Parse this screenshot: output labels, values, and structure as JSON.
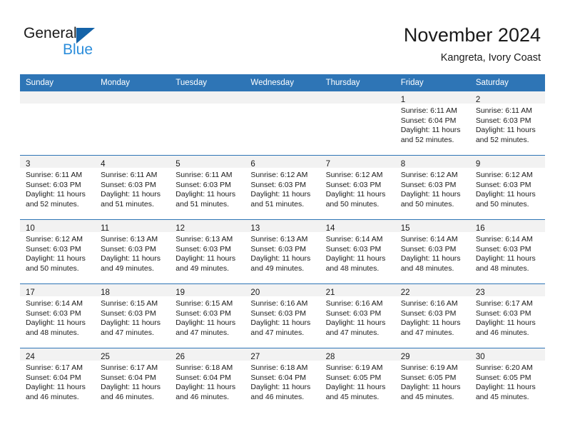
{
  "brand": {
    "line1": "General",
    "line2": "Blue",
    "triangle_color": "#1463a8",
    "blue_text_color": "#2b8ddb"
  },
  "header": {
    "title": "November 2024",
    "subtitle": "Kangreta, Ivory Coast"
  },
  "theme": {
    "header_row_bg": "#2e75b6",
    "header_row_text": "#ffffff",
    "daynum_bar_bg": "#f2f2f2",
    "cell_bg": "#ffffff",
    "grid_line": "#2e75b6"
  },
  "columns": [
    "Sunday",
    "Monday",
    "Tuesday",
    "Wednesday",
    "Thursday",
    "Friday",
    "Saturday"
  ],
  "weeks": [
    [
      {
        "day": "",
        "lines": []
      },
      {
        "day": "",
        "lines": []
      },
      {
        "day": "",
        "lines": []
      },
      {
        "day": "",
        "lines": []
      },
      {
        "day": "",
        "lines": []
      },
      {
        "day": "1",
        "lines": [
          "Sunrise: 6:11 AM",
          "Sunset: 6:04 PM",
          "Daylight: 11 hours",
          "and 52 minutes."
        ]
      },
      {
        "day": "2",
        "lines": [
          "Sunrise: 6:11 AM",
          "Sunset: 6:03 PM",
          "Daylight: 11 hours",
          "and 52 minutes."
        ]
      }
    ],
    [
      {
        "day": "3",
        "lines": [
          "Sunrise: 6:11 AM",
          "Sunset: 6:03 PM",
          "Daylight: 11 hours",
          "and 52 minutes."
        ]
      },
      {
        "day": "4",
        "lines": [
          "Sunrise: 6:11 AM",
          "Sunset: 6:03 PM",
          "Daylight: 11 hours",
          "and 51 minutes."
        ]
      },
      {
        "day": "5",
        "lines": [
          "Sunrise: 6:11 AM",
          "Sunset: 6:03 PM",
          "Daylight: 11 hours",
          "and 51 minutes."
        ]
      },
      {
        "day": "6",
        "lines": [
          "Sunrise: 6:12 AM",
          "Sunset: 6:03 PM",
          "Daylight: 11 hours",
          "and 51 minutes."
        ]
      },
      {
        "day": "7",
        "lines": [
          "Sunrise: 6:12 AM",
          "Sunset: 6:03 PM",
          "Daylight: 11 hours",
          "and 50 minutes."
        ]
      },
      {
        "day": "8",
        "lines": [
          "Sunrise: 6:12 AM",
          "Sunset: 6:03 PM",
          "Daylight: 11 hours",
          "and 50 minutes."
        ]
      },
      {
        "day": "9",
        "lines": [
          "Sunrise: 6:12 AM",
          "Sunset: 6:03 PM",
          "Daylight: 11 hours",
          "and 50 minutes."
        ]
      }
    ],
    [
      {
        "day": "10",
        "lines": [
          "Sunrise: 6:12 AM",
          "Sunset: 6:03 PM",
          "Daylight: 11 hours",
          "and 50 minutes."
        ]
      },
      {
        "day": "11",
        "lines": [
          "Sunrise: 6:13 AM",
          "Sunset: 6:03 PM",
          "Daylight: 11 hours",
          "and 49 minutes."
        ]
      },
      {
        "day": "12",
        "lines": [
          "Sunrise: 6:13 AM",
          "Sunset: 6:03 PM",
          "Daylight: 11 hours",
          "and 49 minutes."
        ]
      },
      {
        "day": "13",
        "lines": [
          "Sunrise: 6:13 AM",
          "Sunset: 6:03 PM",
          "Daylight: 11 hours",
          "and 49 minutes."
        ]
      },
      {
        "day": "14",
        "lines": [
          "Sunrise: 6:14 AM",
          "Sunset: 6:03 PM",
          "Daylight: 11 hours",
          "and 48 minutes."
        ]
      },
      {
        "day": "15",
        "lines": [
          "Sunrise: 6:14 AM",
          "Sunset: 6:03 PM",
          "Daylight: 11 hours",
          "and 48 minutes."
        ]
      },
      {
        "day": "16",
        "lines": [
          "Sunrise: 6:14 AM",
          "Sunset: 6:03 PM",
          "Daylight: 11 hours",
          "and 48 minutes."
        ]
      }
    ],
    [
      {
        "day": "17",
        "lines": [
          "Sunrise: 6:14 AM",
          "Sunset: 6:03 PM",
          "Daylight: 11 hours",
          "and 48 minutes."
        ]
      },
      {
        "day": "18",
        "lines": [
          "Sunrise: 6:15 AM",
          "Sunset: 6:03 PM",
          "Daylight: 11 hours",
          "and 47 minutes."
        ]
      },
      {
        "day": "19",
        "lines": [
          "Sunrise: 6:15 AM",
          "Sunset: 6:03 PM",
          "Daylight: 11 hours",
          "and 47 minutes."
        ]
      },
      {
        "day": "20",
        "lines": [
          "Sunrise: 6:16 AM",
          "Sunset: 6:03 PM",
          "Daylight: 11 hours",
          "and 47 minutes."
        ]
      },
      {
        "day": "21",
        "lines": [
          "Sunrise: 6:16 AM",
          "Sunset: 6:03 PM",
          "Daylight: 11 hours",
          "and 47 minutes."
        ]
      },
      {
        "day": "22",
        "lines": [
          "Sunrise: 6:16 AM",
          "Sunset: 6:03 PM",
          "Daylight: 11 hours",
          "and 47 minutes."
        ]
      },
      {
        "day": "23",
        "lines": [
          "Sunrise: 6:17 AM",
          "Sunset: 6:03 PM",
          "Daylight: 11 hours",
          "and 46 minutes."
        ]
      }
    ],
    [
      {
        "day": "24",
        "lines": [
          "Sunrise: 6:17 AM",
          "Sunset: 6:04 PM",
          "Daylight: 11 hours",
          "and 46 minutes."
        ]
      },
      {
        "day": "25",
        "lines": [
          "Sunrise: 6:17 AM",
          "Sunset: 6:04 PM",
          "Daylight: 11 hours",
          "and 46 minutes."
        ]
      },
      {
        "day": "26",
        "lines": [
          "Sunrise: 6:18 AM",
          "Sunset: 6:04 PM",
          "Daylight: 11 hours",
          "and 46 minutes."
        ]
      },
      {
        "day": "27",
        "lines": [
          "Sunrise: 6:18 AM",
          "Sunset: 6:04 PM",
          "Daylight: 11 hours",
          "and 46 minutes."
        ]
      },
      {
        "day": "28",
        "lines": [
          "Sunrise: 6:19 AM",
          "Sunset: 6:05 PM",
          "Daylight: 11 hours",
          "and 45 minutes."
        ]
      },
      {
        "day": "29",
        "lines": [
          "Sunrise: 6:19 AM",
          "Sunset: 6:05 PM",
          "Daylight: 11 hours",
          "and 45 minutes."
        ]
      },
      {
        "day": "30",
        "lines": [
          "Sunrise: 6:20 AM",
          "Sunset: 6:05 PM",
          "Daylight: 11 hours",
          "and 45 minutes."
        ]
      }
    ]
  ]
}
